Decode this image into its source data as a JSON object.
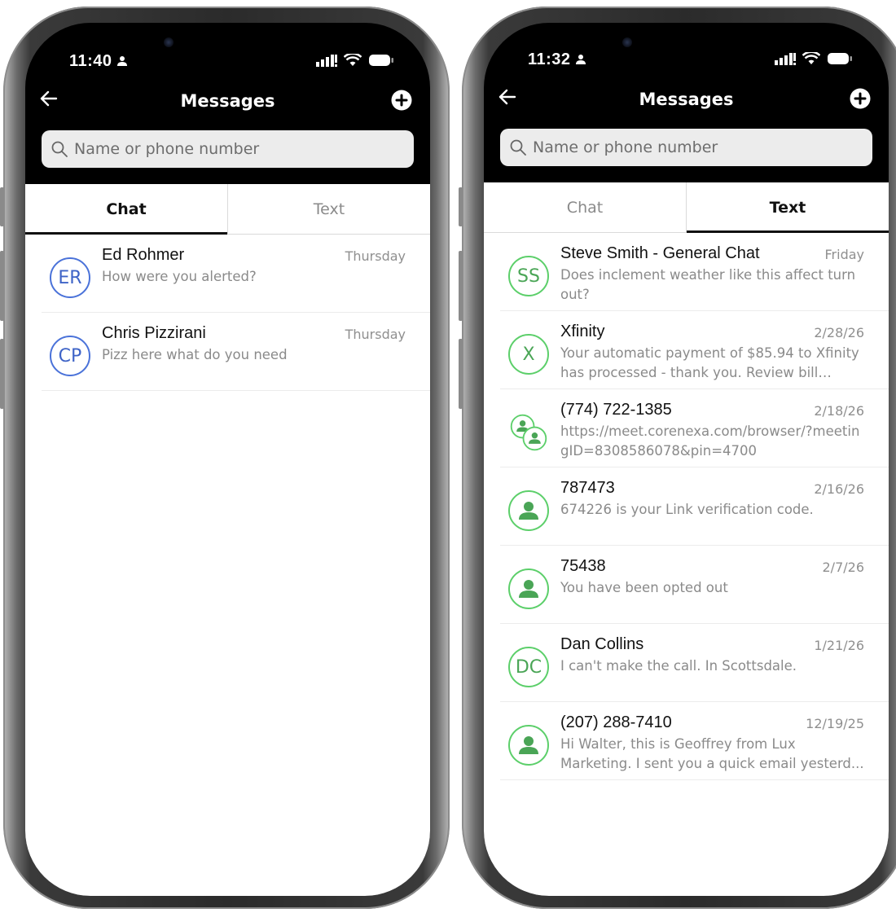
{
  "left_phone": {
    "status": {
      "time": "11:40"
    },
    "header": {
      "title": "Messages"
    },
    "search": {
      "placeholder": "Name or phone number"
    },
    "tabs": [
      {
        "label": "Chat",
        "active": true
      },
      {
        "label": "Text",
        "active": false
      }
    ],
    "conversations": [
      {
        "initials": "ER",
        "name": "Ed Rohmer",
        "date": "Thursday",
        "preview": "How were you alerted?"
      },
      {
        "initials": "CP",
        "name": "Chris Pizzirani",
        "date": "Thursday",
        "preview": "Pizz here what do you need"
      }
    ]
  },
  "right_phone": {
    "status": {
      "time": "11:32"
    },
    "header": {
      "title": "Messages"
    },
    "search": {
      "placeholder": "Name or phone number"
    },
    "tabs": [
      {
        "label": "Chat",
        "active": false
      },
      {
        "label": "Text",
        "active": true
      }
    ],
    "conversations": [
      {
        "avatar": "SS",
        "avatar_type": "initials",
        "name": "Steve Smith - General Chat",
        "date": "Friday",
        "preview": "Does inclement weather like this affect turn out?"
      },
      {
        "avatar": "X",
        "avatar_type": "initials",
        "name": "Xfinity",
        "date": "2/28/26",
        "preview": "Your automatic payment of $85.94 to Xfinity has processed - thank you. Review bill deta..."
      },
      {
        "avatar": "group-person-icon",
        "avatar_type": "group",
        "name": "(774) 722-1385",
        "date": "2/18/26",
        "preview": "https://meet.corenexa.com/browser/?meetingID=8308586078&pin=4700"
      },
      {
        "avatar": "person-icon",
        "avatar_type": "person",
        "name": "787473",
        "date": "2/16/26",
        "preview": "674226 is your Link verification code."
      },
      {
        "avatar": "person-icon",
        "avatar_type": "person",
        "name": "75438",
        "date": "2/7/26",
        "preview": "You have been opted out"
      },
      {
        "avatar": "DC",
        "avatar_type": "initials",
        "name": "Dan Collins",
        "date": "1/21/26",
        "preview": "I can't make the call. In Scottsdale."
      },
      {
        "avatar": "person-icon",
        "avatar_type": "person",
        "name": "(207) 288-7410",
        "date": "12/19/25",
        "preview": "Hi Walter, this is Geoffrey from Lux Marketing. I sent you a quick email yesterd..."
      }
    ]
  },
  "colors": {
    "chat_avatar": "#4a72d9",
    "text_avatar": "#5ccf6a",
    "header_bg": "#000000",
    "search_bg": "#ececec"
  }
}
